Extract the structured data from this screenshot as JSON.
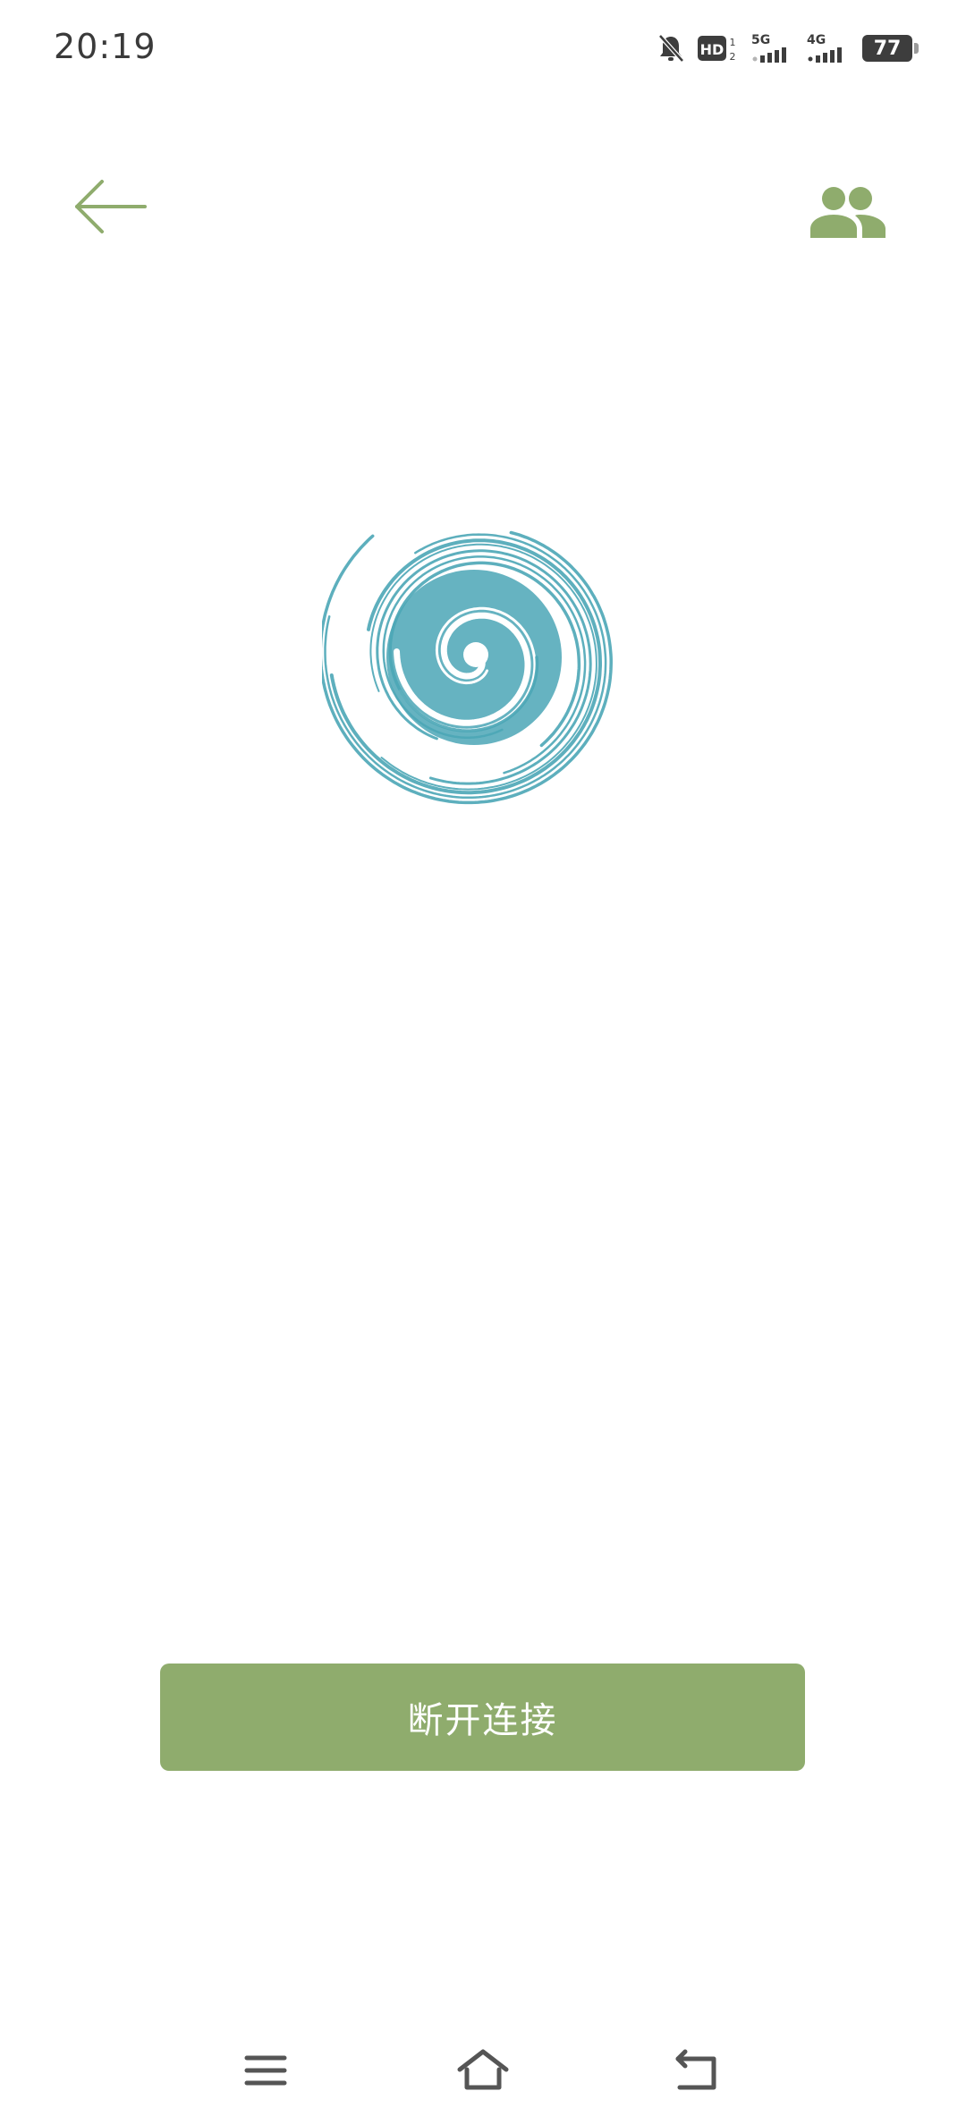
{
  "status_bar": {
    "time": "20:19",
    "icons": [
      "mute-bell-icon",
      "hd-icon",
      "5g-signal-icon",
      "4g-signal-icon"
    ],
    "hd_label": "HD",
    "network_1": "5G",
    "network_2": "4G",
    "battery_level": "77"
  },
  "header": {
    "back_icon": "arrow-left-icon",
    "users_icon": "users-icon"
  },
  "main": {
    "spiral_icon": "spiral-connecting-icon",
    "disconnect_label": "断开连接"
  },
  "nav_bar": {
    "menu_icon": "menu-icon",
    "home_icon": "home-icon",
    "back_icon": "back-nav-icon"
  },
  "colors": {
    "accent_green": "#8fac6d",
    "spiral_teal": "#4ba6b6",
    "text_dark": "#3a3a3a",
    "nav_gray": "#555555"
  }
}
